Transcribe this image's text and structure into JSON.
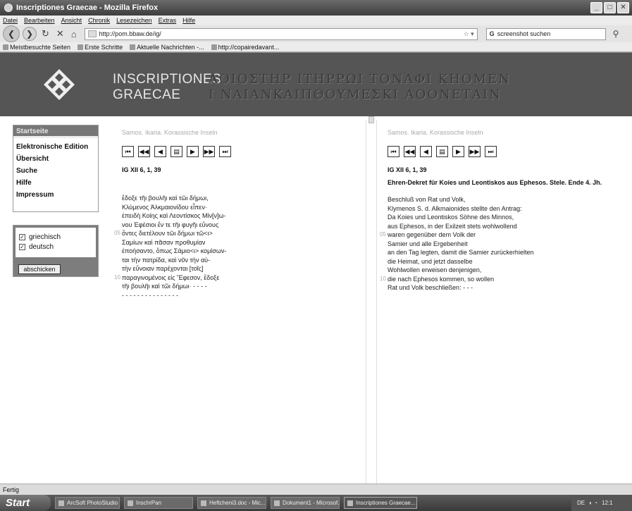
{
  "window": {
    "title": "Inscriptiones Graecae - Mozilla Firefox"
  },
  "menu": [
    "Datei",
    "Bearbeiten",
    "Ansicht",
    "Chronik",
    "Lesezeichen",
    "Extras",
    "Hilfe"
  ],
  "nav": {
    "url": "http://pom.bbaw.de/ig/",
    "search_placeholder": "screenshot suchen"
  },
  "bookmarks": [
    "Meistbesuchte Seiten",
    "Erste Schritte",
    "Aktuelle Nachrichten -...",
    "http://copairedavant..."
  ],
  "banner": {
    "title_line1": "INSCRIPTIONES",
    "title_line2": "GRAECAE",
    "greek_line1": "ΑΟΙΟΣΤΗΡ  ΙΤΗΡΡΩΙ  ΤΟΝΑΦΙ  ΚΗΟΜΕΝ",
    "greek_line2": "Ι  ΝΑΙΑΝΚΑΙΠΘΟΥΜΕΣΚΙ  ΑΟΟΝΕΤΑΙΝ"
  },
  "sidebar": {
    "header": "Startseite",
    "items": [
      "Elektronische Edition",
      "Übersicht",
      "Suche",
      "Hilfe",
      "Impressum"
    ],
    "languages": [
      {
        "label": "griechisch",
        "checked": true
      },
      {
        "label": "deutsch",
        "checked": true
      }
    ],
    "submit_label": "abschicken"
  },
  "pane_greek": {
    "breadcrumb": "Samos. Ikaria. Korassische Inseln",
    "pager": [
      "⏮",
      "◀◀",
      "◀",
      "▤",
      "▶",
      "▶▶",
      "⏭"
    ],
    "reference": "IG XII 6, 1, 39",
    "lines": [
      {
        "n": "",
        "text": "ἔδοξε τῆι βουλῆι καὶ τῶι δήμωι,"
      },
      {
        "n": "",
        "text": "Κλύμενος Ἀλκμαιονίδου εἶπεν·"
      },
      {
        "n": "",
        "text": "ἐπειδὴ Κοίης καὶ Λεοντίσκος Μίν[ν]ω-"
      },
      {
        "n": "",
        "text": "νου Ἐφέσιοι ἔν τε τῆι φυγῆι εὔνους"
      },
      {
        "n": "05",
        "text": "ὄντες διετέλουν τῶι δήμωι τῶ<ι>"
      },
      {
        "n": "",
        "text": "Σαμίων καὶ πᾶσαν προθυμίαν"
      },
      {
        "n": "",
        "text": "ἐποήσαντο, ὅπως Σάμιο<ι> κομίσων-"
      },
      {
        "n": "",
        "text": "ται τὴν πατρίδα, καὶ νῦν τὴν αὐ-"
      },
      {
        "n": "",
        "text": "τὴν εὔνοιαν παρέχονται [τοῖς]"
      },
      {
        "n": "10",
        "text": "παραγινομένοις εἰς Ἔφεσον, ἔδοξε"
      },
      {
        "n": "",
        "text": "τῆι βουλῆι καὶ τῶι δήμωι· - - - -"
      },
      {
        "n": "",
        "text": "- - - - - - - - - - - - - - -"
      }
    ]
  },
  "pane_german": {
    "breadcrumb": "Samos. Ikaria. Korassische Inseln",
    "pager": [
      "⏮",
      "◀◀",
      "◀",
      "▤",
      "▶",
      "▶▶",
      "⏭"
    ],
    "reference": "IG XII 6, 1, 39",
    "subtitle": "Ehren-Dekret für Koies und Leontiskos aus Ephesos. Stele. Ende 4. Jh.",
    "lines": [
      {
        "n": "",
        "text": "Beschluß von Rat und Volk,"
      },
      {
        "n": "",
        "text": "Klymenos S. d. Alkmaionides stellte den Antrag:"
      },
      {
        "n": "",
        "text": "Da Koies und Leontiskos Söhne des Minnos,"
      },
      {
        "n": "",
        "text": "aus Ephesos, in der Exilzeit stets wohlwollend"
      },
      {
        "n": "05",
        "text": "waren gegenüber dem Volk der"
      },
      {
        "n": "",
        "text": "Samier und alle Ergebenheit"
      },
      {
        "n": "",
        "text": "an den Tag legten, damit die Samier zurückerhielten"
      },
      {
        "n": "",
        "text": "die Heimat, und jetzt dasselbe"
      },
      {
        "n": "",
        "text": "Wohlwollen erweisen denjenigen,"
      },
      {
        "n": "10",
        "text": "die nach Ephesos kommen, so wollen"
      },
      {
        "n": "",
        "text": "Rat und Volk beschließen: - - -"
      }
    ]
  },
  "status": "Fertig",
  "taskbar": {
    "start": "Start",
    "tasks": [
      "ArcSoft PhotoStudio",
      "InschrPan",
      "Heftcheni3.doc - Mic...",
      "Dokument1 - Microsof...",
      "Inscriptiones Graecae..."
    ],
    "tray_lang": "DE",
    "clock": "12:1"
  }
}
